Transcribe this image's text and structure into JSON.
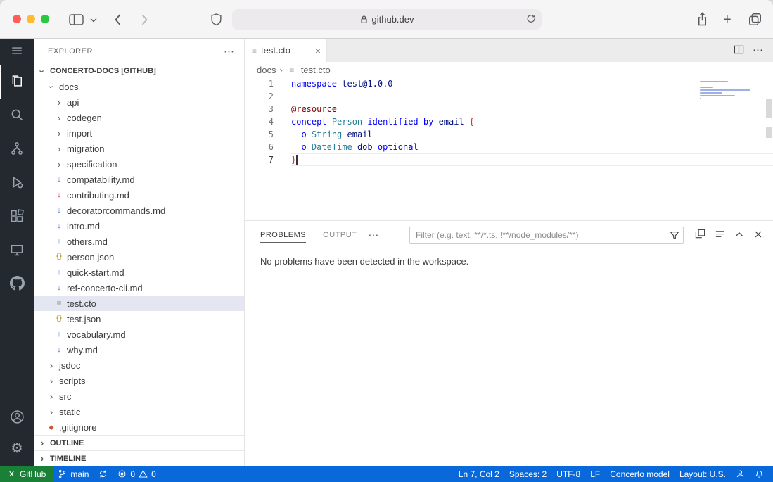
{
  "colors": {
    "status_bar_blue": "#0969da",
    "remote_green": "#1a7f37",
    "selection_bg": "#e4e6f1"
  },
  "browser": {
    "url": "github.dev"
  },
  "activity_bar": {
    "top": [
      {
        "name": "menu",
        "active": false
      },
      {
        "name": "explorer",
        "active": true
      },
      {
        "name": "search",
        "active": false
      },
      {
        "name": "source-control",
        "active": false
      },
      {
        "name": "run-debug",
        "active": false
      },
      {
        "name": "extensions",
        "active": false
      },
      {
        "name": "remote-explorer",
        "active": false
      },
      {
        "name": "github",
        "active": false
      }
    ],
    "bottom": [
      {
        "name": "account",
        "active": false
      },
      {
        "name": "settings",
        "active": false
      }
    ]
  },
  "sidebar": {
    "title": "EXPLORER",
    "root_label": "CONCERTO-DOCS [GITHUB]",
    "tree": [
      {
        "label": "docs",
        "kind": "folder",
        "expanded": true,
        "indent": 1
      },
      {
        "label": "api",
        "kind": "folder",
        "indent": 2
      },
      {
        "label": "codegen",
        "kind": "folder",
        "indent": 2
      },
      {
        "label": "import",
        "kind": "folder",
        "indent": 2
      },
      {
        "label": "migration",
        "kind": "folder",
        "indent": 2
      },
      {
        "label": "specification",
        "kind": "folder",
        "indent": 2
      },
      {
        "label": "compatability.md",
        "kind": "md",
        "indent": 2
      },
      {
        "label": "contributing.md",
        "kind": "md-red",
        "indent": 2
      },
      {
        "label": "decoratorcommands.md",
        "kind": "md",
        "indent": 2
      },
      {
        "label": "intro.md",
        "kind": "md",
        "indent": 2
      },
      {
        "label": "others.md",
        "kind": "md",
        "indent": 2
      },
      {
        "label": "person.json",
        "kind": "json",
        "indent": 2
      },
      {
        "label": "quick-start.md",
        "kind": "md",
        "indent": 2
      },
      {
        "label": "ref-concerto-cli.md",
        "kind": "md",
        "indent": 2
      },
      {
        "label": "test.cto",
        "kind": "file",
        "indent": 2,
        "selected": true
      },
      {
        "label": "test.json",
        "kind": "json",
        "indent": 2
      },
      {
        "label": "vocabulary.md",
        "kind": "md",
        "indent": 2
      },
      {
        "label": "why.md",
        "kind": "md",
        "indent": 2
      },
      {
        "label": "jsdoc",
        "kind": "folder",
        "indent": 1
      },
      {
        "label": "scripts",
        "kind": "folder",
        "indent": 1
      },
      {
        "label": "src",
        "kind": "folder",
        "indent": 1
      },
      {
        "label": "static",
        "kind": "folder",
        "indent": 1
      },
      {
        "label": ".gitignore",
        "kind": "git",
        "indent": 1
      }
    ],
    "sections": [
      "OUTLINE",
      "TIMELINE"
    ]
  },
  "editor": {
    "tab_label": "test.cto",
    "breadcrumb": [
      "docs",
      "test.cto"
    ],
    "lines": [
      {
        "n": "1",
        "tokens": [
          [
            "namespace",
            "kw"
          ],
          [
            " ",
            ""
          ],
          [
            "test@1.0.0",
            "id"
          ]
        ]
      },
      {
        "n": "2",
        "tokens": []
      },
      {
        "n": "3",
        "tokens": [
          [
            "@resource",
            "dec"
          ]
        ]
      },
      {
        "n": "4",
        "tokens": [
          [
            "concept",
            "kw"
          ],
          [
            " ",
            ""
          ],
          [
            "Person",
            "type"
          ],
          [
            " ",
            ""
          ],
          [
            "identified",
            "kw"
          ],
          [
            " ",
            ""
          ],
          [
            "by",
            "kw"
          ],
          [
            " ",
            ""
          ],
          [
            "email",
            "id"
          ],
          [
            " ",
            ""
          ],
          [
            "{",
            "brace"
          ]
        ]
      },
      {
        "n": "5",
        "tokens": [
          [
            "  ",
            ""
          ],
          [
            "o",
            "kw"
          ],
          [
            " ",
            ""
          ],
          [
            "String",
            "type"
          ],
          [
            " ",
            ""
          ],
          [
            "email",
            "id"
          ]
        ]
      },
      {
        "n": "6",
        "tokens": [
          [
            "  ",
            ""
          ],
          [
            "o",
            "kw"
          ],
          [
            " ",
            ""
          ],
          [
            "DateTime",
            "type"
          ],
          [
            " ",
            ""
          ],
          [
            "dob",
            "id"
          ],
          [
            " ",
            ""
          ],
          [
            "optional",
            "kw"
          ]
        ]
      },
      {
        "n": "7",
        "tokens": [
          [
            "}",
            "brace"
          ]
        ],
        "cursor": true,
        "current": true
      }
    ]
  },
  "panel": {
    "tabs": [
      {
        "label": "PROBLEMS",
        "active": true
      },
      {
        "label": "OUTPUT",
        "active": false
      }
    ],
    "filter_placeholder": "Filter (e.g. text, **/*.ts, !**/node_modules/**)",
    "message": "No problems have been detected in the workspace."
  },
  "status_bar": {
    "remote_label": "GitHub",
    "branch": "main",
    "error_count": "0",
    "warning_count": "0",
    "right_items": [
      "Ln 7, Col 2",
      "Spaces: 2",
      "UTF-8",
      "LF",
      "Concerto model",
      "Layout: U.S."
    ]
  }
}
